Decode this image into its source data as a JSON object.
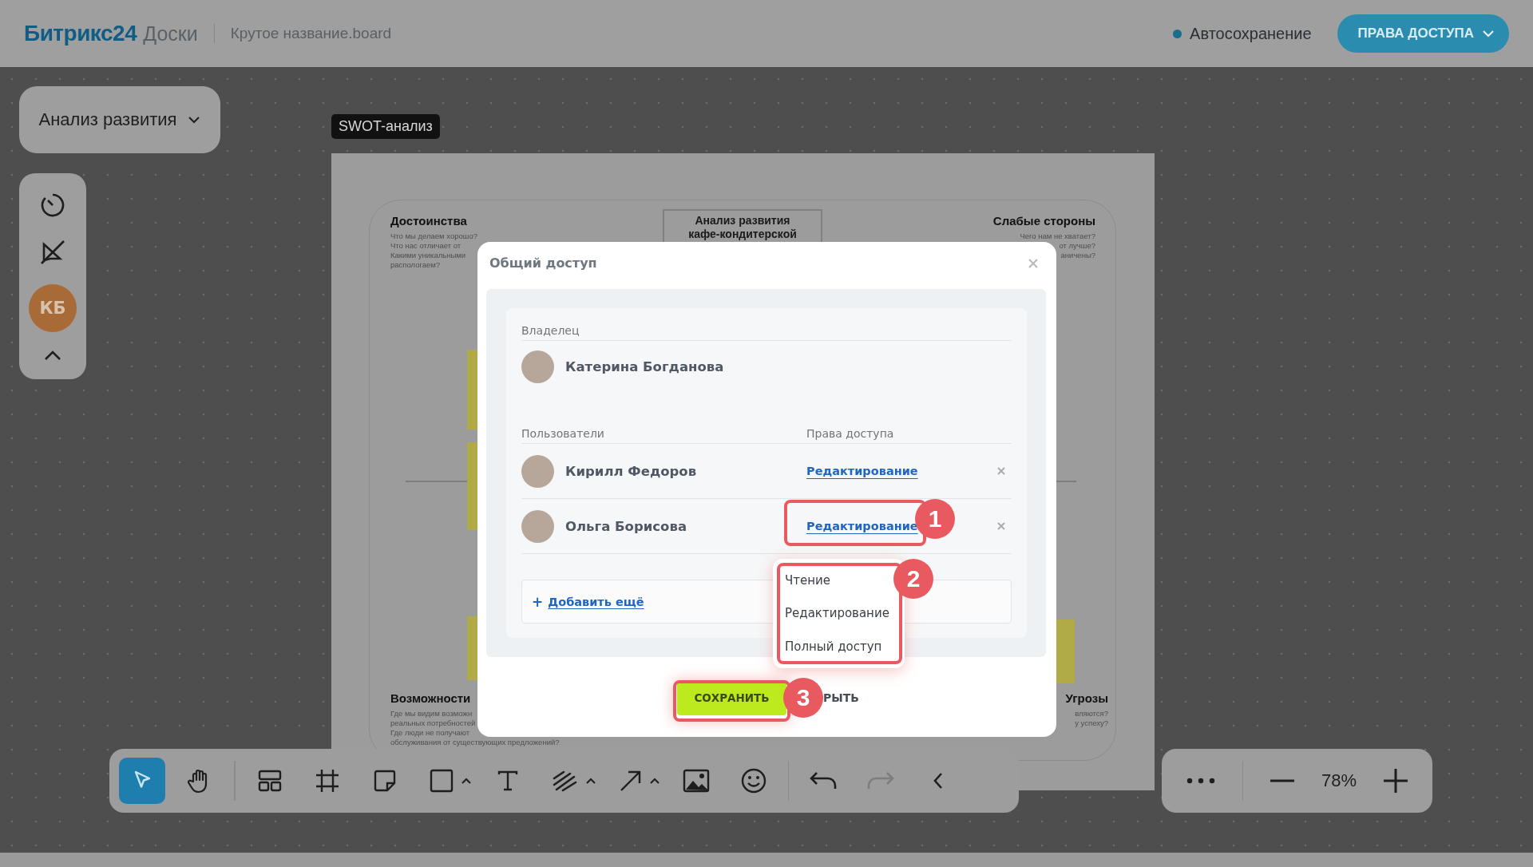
{
  "header": {
    "brand": "Битрикс24",
    "product": "Доски",
    "file_name": "Крутое название.board",
    "autosave": "Автосохранение",
    "access_button": "ПРАВА ДОСТУПА"
  },
  "board_selector": "Анализ развития",
  "left_panel": {
    "user_initials": "КБ"
  },
  "frame_label": "SWOT-анализ",
  "board": {
    "center_title": [
      "Анализ развития",
      "кафе-кондитерской"
    ],
    "quadrants": [
      {
        "kind": "top-left",
        "heading": "Достоинства",
        "lines": [
          "Что мы делаем хорошо?",
          "Что нас отличает от",
          "Какими уникальными",
          "распологаем?"
        ]
      },
      {
        "kind": "top-right",
        "heading": "Слабые стороны",
        "lines": [
          "Чего нам не хватает?",
          "от лучше?",
          "аничены?"
        ]
      },
      {
        "kind": "bottom-left",
        "heading": "Возможности",
        "lines": [
          "Где мы видим возможн",
          "реальных потребностей",
          "Где люди не получают",
          "обслуживания от существующих предложений?"
        ]
      },
      {
        "kind": "bottom-right",
        "heading": "Угрозы",
        "lines": [
          "вляются?",
          "у успеху?"
        ]
      }
    ]
  },
  "dialog": {
    "title": "Общий доступ",
    "owner_label": "Владелец",
    "owner": {
      "name": "Катерина Богданова"
    },
    "users_label": "Пользователи",
    "rights_label": "Права доступа",
    "users": [
      {
        "name": "Кирилл Федоров",
        "access": "Редактирование"
      },
      {
        "name": "Ольга Борисова",
        "access": "Редактирование"
      }
    ],
    "add_icon": "+",
    "add_link": "Добавить ещё",
    "menu": [
      {
        "label": "Чтение",
        "selected": false
      },
      {
        "label": "Редактирование",
        "selected": false
      },
      {
        "label": "Полный доступ",
        "selected": false
      }
    ],
    "save": "СОХРАНИТЬ",
    "close_partial": "РЫТЬ"
  },
  "callouts": [
    "1",
    "2",
    "3"
  ],
  "tools": [
    {
      "kind": "pointer",
      "selected": true,
      "has_menu": false,
      "disabled": false
    },
    {
      "kind": "hand",
      "selected": false,
      "has_menu": false,
      "disabled": false
    },
    {
      "kind": "sep"
    },
    {
      "kind": "layout",
      "selected": false,
      "has_menu": false,
      "disabled": false
    },
    {
      "kind": "frame",
      "selected": false,
      "has_menu": false,
      "disabled": false
    },
    {
      "kind": "sticky",
      "selected": false,
      "has_menu": false,
      "disabled": false
    },
    {
      "kind": "square",
      "selected": false,
      "has_menu": true,
      "disabled": false
    },
    {
      "kind": "text",
      "selected": false,
      "has_menu": false,
      "disabled": false
    },
    {
      "kind": "pen",
      "selected": false,
      "has_menu": true,
      "disabled": false
    },
    {
      "kind": "arrow",
      "selected": false,
      "has_menu": true,
      "disabled": false
    },
    {
      "kind": "image",
      "selected": false,
      "has_menu": false,
      "disabled": false
    },
    {
      "kind": "emoji",
      "selected": false,
      "has_menu": false,
      "disabled": false
    },
    {
      "kind": "sep"
    },
    {
      "kind": "undo",
      "selected": false,
      "has_menu": false,
      "disabled": false
    },
    {
      "kind": "redo",
      "selected": false,
      "has_menu": false,
      "disabled": true
    },
    {
      "kind": "collapse",
      "selected": false,
      "has_menu": false,
      "disabled": false
    }
  ],
  "zoom": "78%"
}
